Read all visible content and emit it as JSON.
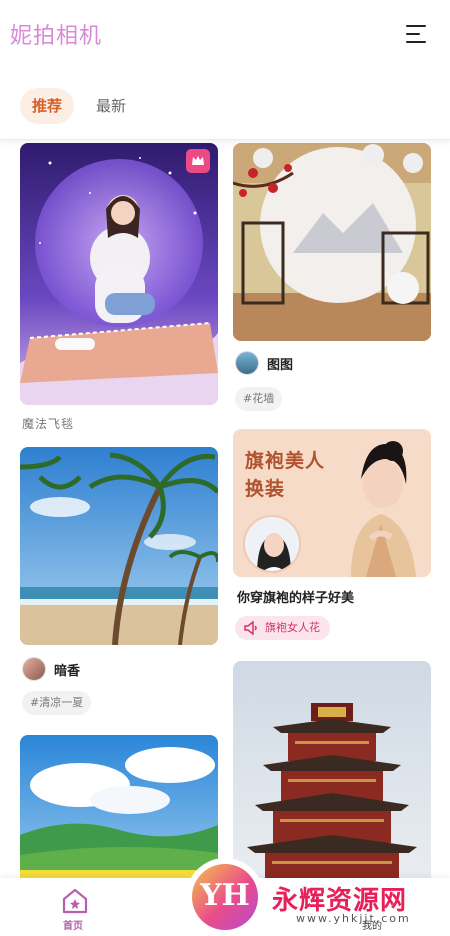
{
  "app": {
    "title": "妮拍相机"
  },
  "tabs": [
    {
      "label": "推荐",
      "active": true
    },
    {
      "label": "最新",
      "active": false
    }
  ],
  "feed": {
    "left": [
      {
        "caption": "魔法飞毯",
        "badge_icon": "crown-icon"
      },
      {
        "user": "暗香",
        "tag": "#清凉一夏"
      },
      {
        "caption": ""
      }
    ],
    "right": [
      {
        "user": "图图",
        "tag": "#花墙"
      },
      {
        "banner_title_line1": "旗袍美人",
        "banner_title_line2": "换装",
        "title": "你穿旗袍的样子好美",
        "tag": "旗袍女人花"
      },
      {
        "caption": ""
      }
    ]
  },
  "bottom_nav": {
    "home_label": "首页",
    "mine_label": "我的",
    "center_logo_text": "YH"
  },
  "watermark": {
    "text": "永辉资源网",
    "url": "www.yhkjjt.com"
  },
  "colors": {
    "accent": "#d9622b",
    "brand": "#d889d8",
    "tag_pink": "#d4346a"
  }
}
